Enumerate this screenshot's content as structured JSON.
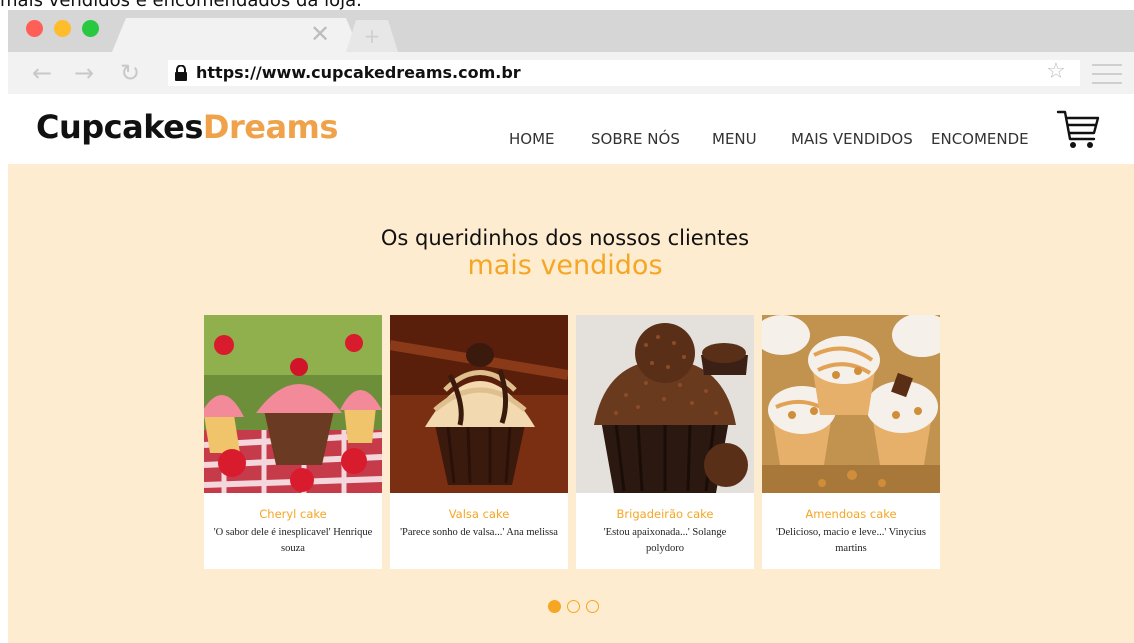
{
  "top_caption": "mais vendidos e encomendados da loja.",
  "browser": {
    "url": "https://www.cupcakedreams.com.br",
    "tab_close_glyph": "✕",
    "new_tab_glyph": "+",
    "back_glyph": "←",
    "forward_glyph": "→",
    "reload_glyph": "↻",
    "star_glyph": "☆",
    "icons": [
      "lock-icon",
      "star-icon",
      "menu-icon",
      "close-icon",
      "plus-icon"
    ]
  },
  "site": {
    "logo_part1": "Cupcakes",
    "logo_part2": "Dreams",
    "nav": [
      "HOME",
      "SOBRE NÓS",
      "MENU",
      "MAIS VENDIDOS",
      "ENCOMENDE"
    ],
    "cart_icon": "shopping-cart-icon"
  },
  "hero": {
    "title": "Os queridinhos dos nossos clientes",
    "subtitle": "mais vendidos",
    "cards": [
      {
        "name": "Cheryl cake",
        "review": "'O sabor dele é inesplicavel' Henrique souza"
      },
      {
        "name": "Valsa cake",
        "review": "'Parece sonho de valsa...' Ana melissa"
      },
      {
        "name": "Brigadeirão cake",
        "review": "'Estou apaixonada...' Solange polydoro"
      },
      {
        "name": "Amendoas cake",
        "review": "'Delicioso, macio e leve...' Vinycius martins"
      }
    ],
    "carousel_pages": 3,
    "carousel_active": 1
  },
  "colors": {
    "accent": "#f5a623",
    "logo_accent": "#f0a24a",
    "hero_bg": "#feecd1",
    "chrome_bg": "#d6d6d6"
  }
}
